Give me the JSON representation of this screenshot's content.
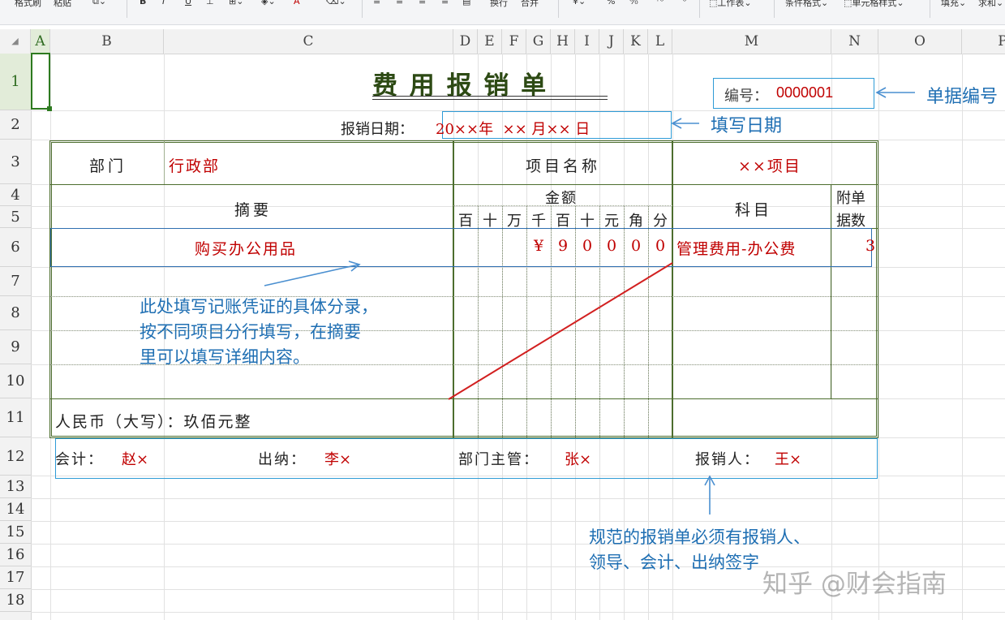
{
  "ribbon": {
    "items": [
      "格式刷",
      "粘贴",
      "",
      "B",
      "I",
      "U",
      "",
      "",
      "",
      "A",
      "",
      "",
      "",
      "",
      "",
      "",
      "换行",
      "合并",
      "",
      "%",
      "",
      "",
      "工作表",
      "条件格式",
      "单元格样式",
      "填充",
      "求和"
    ]
  },
  "columns": [
    "A",
    "B",
    "C",
    "D",
    "E",
    "F",
    "G",
    "H",
    "I",
    "J",
    "K",
    "L",
    "M",
    "N",
    "O",
    "P"
  ],
  "rows": [
    "1",
    "2",
    "3",
    "4",
    "5",
    "6",
    "7",
    "8",
    "9",
    "10",
    "11",
    "12",
    "13",
    "14",
    "15",
    "16",
    "17",
    "18"
  ],
  "form": {
    "title": "费 用 报 销 单",
    "number_label": "编号：",
    "number_value": "0000001",
    "date_label": "报销日期：",
    "date_value": "20××年  ×× 月×× 日",
    "dept_label": "部门",
    "dept_value": "行政部",
    "project_label": "项目名称",
    "project_value": "××项目",
    "summary_label": "摘要",
    "amount_label": "金额",
    "amount_units": [
      "百",
      "十",
      "万",
      "千",
      "百",
      "十",
      "元",
      "角",
      "分"
    ],
    "subject_label": "科目",
    "attach_label_1": "附单",
    "attach_label_2": "据数",
    "item_desc": "购买办公用品",
    "item_digits": [
      "",
      "",
      "",
      "¥",
      "9",
      "0",
      "0",
      "0",
      "0"
    ],
    "item_subject": "管理费用-办公费",
    "item_attach": "3",
    "rmb_label": "人民币（大写）：玖佰元整",
    "accountant_label": "会计：",
    "accountant_value": "赵×",
    "cashier_label": "出纳：",
    "cashier_value": "李×",
    "manager_label": "部门主管：",
    "manager_value": "张×",
    "claimant_label": "报销人：",
    "claimant_value": "王×"
  },
  "annotations": {
    "number_note": "单据编号",
    "date_note": "填写日期",
    "entry_note_1": "此处填写记账凭证的具体分录，",
    "entry_note_2": "按不同项目分行填写，在摘要",
    "entry_note_3": "里可以填写详细内容。",
    "sign_note_1": "规范的报销单必须有报销人、",
    "sign_note_2": "领导、会计、出纳签字"
  },
  "watermark": "知乎 @财会指南",
  "colors": {
    "accent": "#2e9bd6",
    "red": "#c00000",
    "border": "#4d6e2e",
    "title": "#2d4a14"
  }
}
